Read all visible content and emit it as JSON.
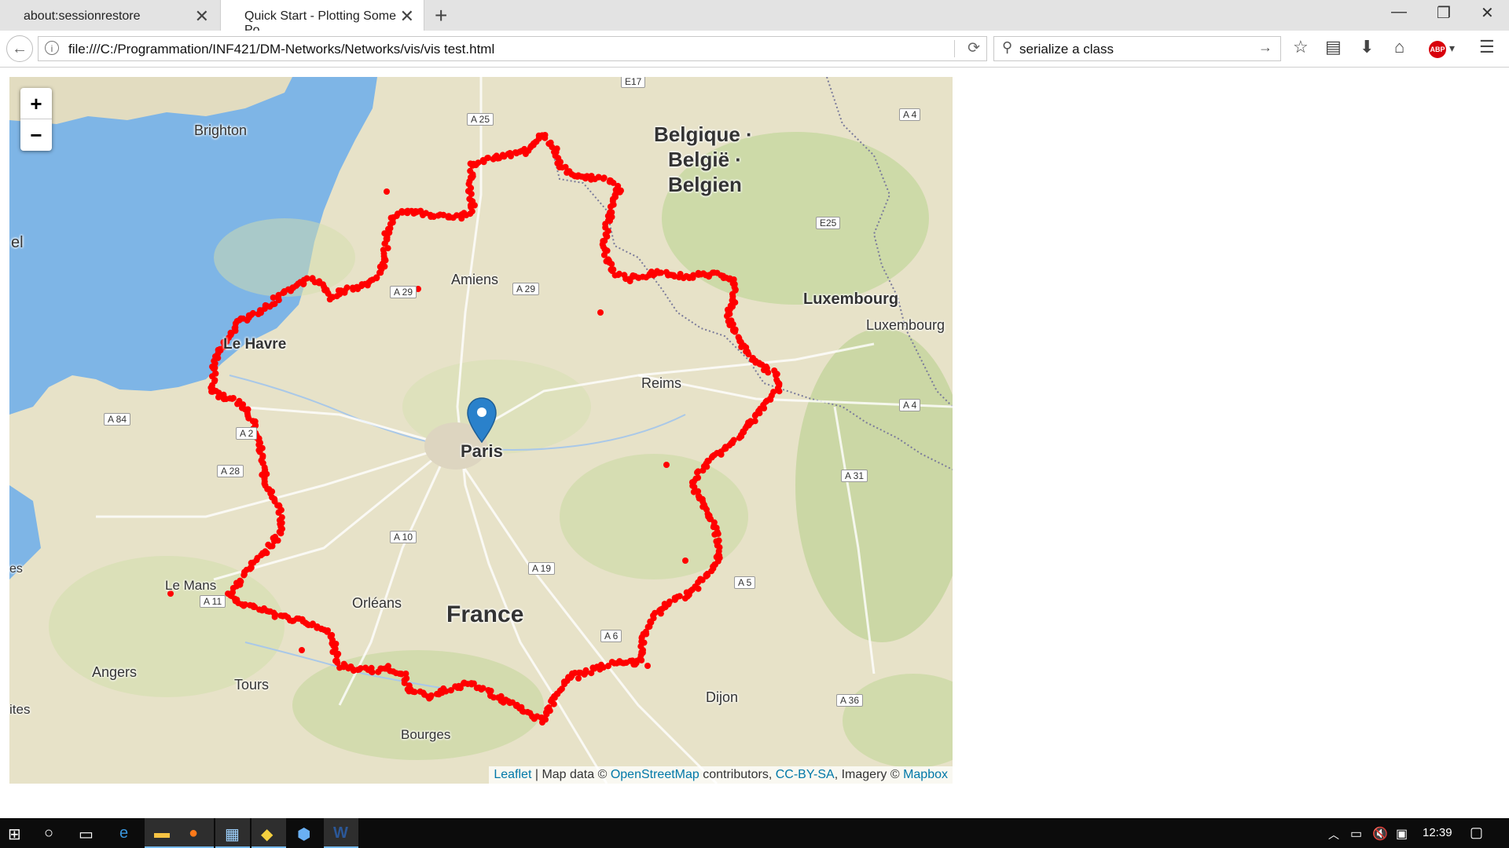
{
  "browser": {
    "tabs": [
      {
        "title": "about:sessionrestore"
      },
      {
        "title": "Quick Start - Plotting Some Po..."
      }
    ],
    "url": "file:///C:/Programmation/INF421/DM-Networks/Networks/vis/vis test.html",
    "search_value": "serialize a class"
  },
  "map": {
    "zoom_in": "+",
    "zoom_out": "−",
    "marker_label": "Paris",
    "route_color": "#ff0000",
    "marker_color": "#2a81cb",
    "sea_color": "#7eb5e6",
    "labels": {
      "brighton": "Brighton",
      "belgique1": "Belgique ·",
      "belgique2": "België ·",
      "belgique3": "Belgien",
      "amiens": "Amiens",
      "luxembourg_country": "Luxembourg",
      "luxembourg_city": "Luxembourg",
      "le_havre": "Le Havre",
      "reims": "Reims",
      "paris": "Paris",
      "le_mans": "Le Mans",
      "orleans": "Orléans",
      "france": "France",
      "angers": "Angers",
      "tours": "Tours",
      "dijon": "Dijon",
      "bourges": "Bourges",
      "nantes": "ites",
      "es": "es",
      "el": "el"
    },
    "roads": {
      "e17": "E17",
      "a25": "A 25",
      "a4n": "A 4",
      "e25": "E25",
      "a29w": "A 29",
      "a29e": "A 29",
      "a84": "A 84",
      "a2": "A 2",
      "a4e": "A 4",
      "a28": "A 28",
      "a31": "A 31",
      "a10": "A 10",
      "a19": "A 19",
      "a5": "A 5",
      "a6": "A 6",
      "a36": "A 36",
      "a11": "A 11"
    },
    "attribution": {
      "leaflet": "Leaflet",
      "sep1": " | Map data © ",
      "osm": "OpenStreetMap",
      "contrib": " contributors, ",
      "license": "CC-BY-SA",
      "imagery": ", Imagery © ",
      "mapbox": "Mapbox"
    }
  },
  "taskbar": {
    "time": "12:39"
  }
}
